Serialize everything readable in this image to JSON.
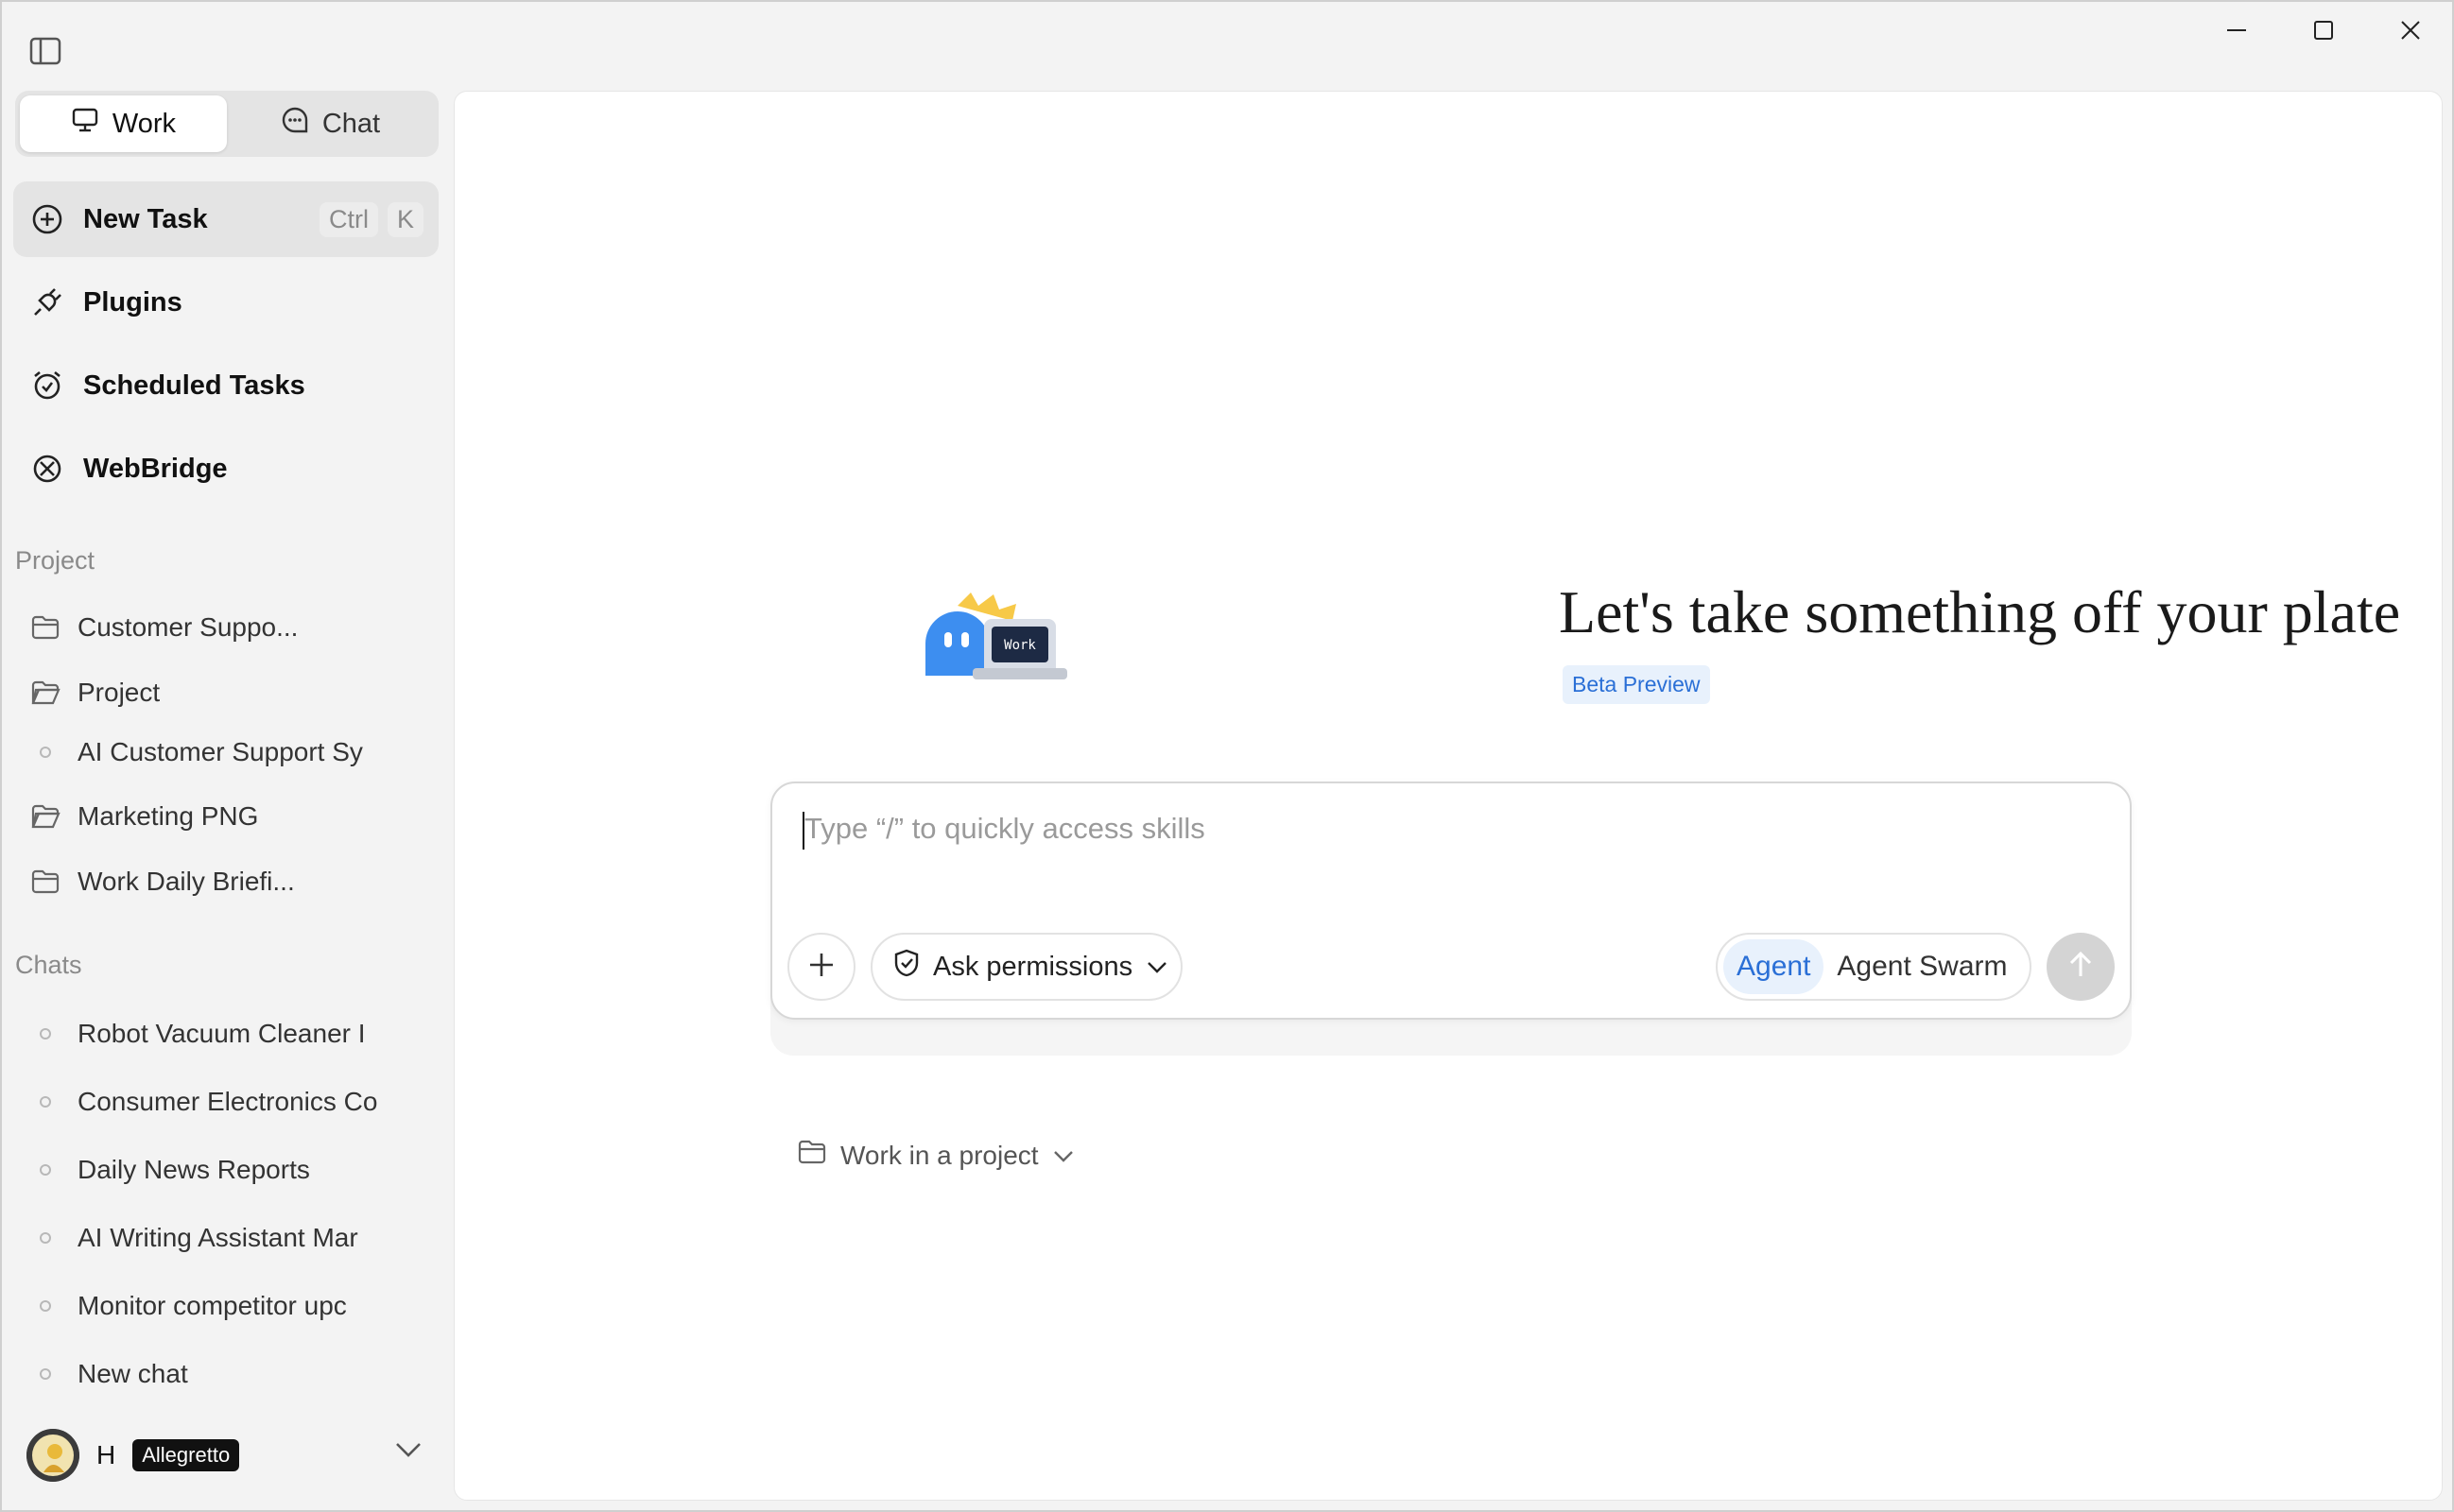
{
  "window": {
    "controls": [
      "minimize",
      "maximize",
      "close"
    ]
  },
  "sidebar": {
    "modes": [
      {
        "label": "Work",
        "icon": "monitor-icon",
        "active": true
      },
      {
        "label": "Chat",
        "icon": "chat-bubble-icon",
        "active": false
      }
    ],
    "nav": [
      {
        "label": "New Task",
        "icon": "plus-circle-icon",
        "shortcut": [
          "Ctrl",
          "K"
        ]
      },
      {
        "label": "Plugins",
        "icon": "plug-icon"
      },
      {
        "label": "Scheduled Tasks",
        "icon": "alarm-clock-icon"
      },
      {
        "label": "WebBridge",
        "icon": "webbridge-icon"
      }
    ],
    "project_section": {
      "label": "Project",
      "items": [
        {
          "label": "Customer Suppo...",
          "type": "folder"
        },
        {
          "label": "Project",
          "type": "folder-open"
        },
        {
          "label": "AI Customer Support Sy",
          "type": "sub"
        },
        {
          "label": "Marketing PNG",
          "type": "folder-open"
        },
        {
          "label": "Work Daily Briefi...",
          "type": "folder"
        }
      ]
    },
    "chats_section": {
      "label": "Chats",
      "items": [
        {
          "label": "Robot Vacuum Cleaner I"
        },
        {
          "label": "Consumer Electronics Co"
        },
        {
          "label": "Daily News Reports"
        },
        {
          "label": "AI Writing Assistant Mar"
        },
        {
          "label": "Monitor competitor upc"
        },
        {
          "label": "New chat"
        }
      ]
    },
    "user": {
      "initial": "H",
      "badge": "Allegretto"
    }
  },
  "main": {
    "hero": {
      "mascot_label": "Work",
      "title": "Let's take something off your plate",
      "badge": "Beta Preview"
    },
    "composer": {
      "placeholder": "Type “/” to quickly access skills",
      "permissions_label": "Ask permissions",
      "agent_modes": [
        {
          "label": "Agent",
          "active": true
        },
        {
          "label": "Agent Swarm",
          "active": false
        }
      ]
    },
    "project_picker": {
      "label": "Work in a project"
    }
  },
  "colors": {
    "accent": "#2a6fd6",
    "accent_bg": "#e8f1fc",
    "sidebar_bg": "#f3f3f3",
    "main_bg": "#ffffff"
  }
}
